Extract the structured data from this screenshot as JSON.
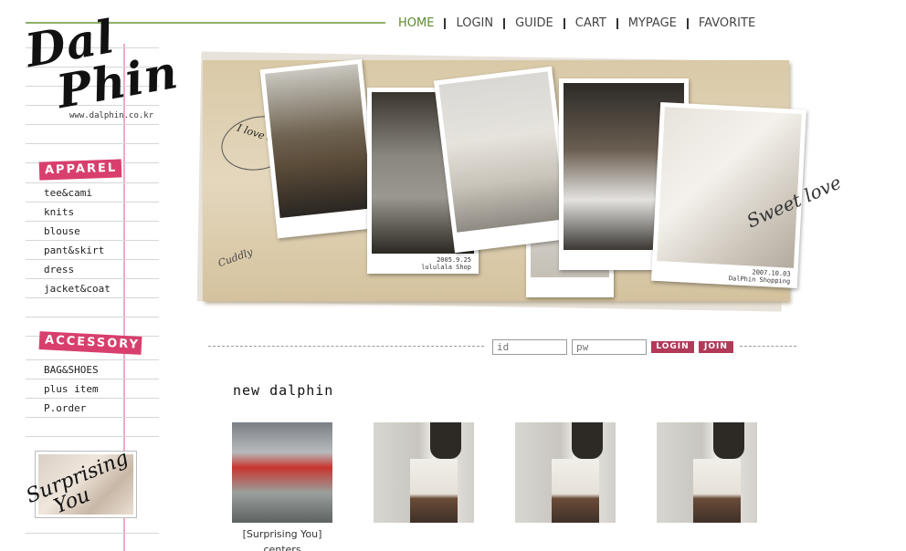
{
  "brand": {
    "logo_line1": "Dal",
    "logo_line2": "Phin",
    "url": "www.dalphin.co.kr"
  },
  "nav": {
    "items": [
      {
        "label": "HOME",
        "active": true
      },
      {
        "label": "LOGIN"
      },
      {
        "label": "GUIDE"
      },
      {
        "label": "CART"
      },
      {
        "label": "MYPAGE"
      },
      {
        "label": "FAVORITE"
      }
    ]
  },
  "sidebar": {
    "apparel_label": "APPAREL",
    "apparel_items": [
      "tee&cami",
      "knits",
      "blouse",
      "pant&skirt",
      "dress",
      "jacket&coat"
    ],
    "accessory_label": "ACCESSORY",
    "accessory_items": [
      "BAG&SHOES",
      "plus item",
      "P.order"
    ],
    "banner_text_1": "Surprising",
    "banner_text_2": "You"
  },
  "hero": {
    "script_ilove": "I love dalphin",
    "script_sweet": "Sweet love",
    "script_cuddly": "Cuddly",
    "caption_1_date": "2005.9.25",
    "caption_1_shop": "lululala Shop",
    "caption_2_date": "2007.10.03",
    "caption_2_shop": "DalPhin Shopping"
  },
  "login": {
    "id_placeholder": "id",
    "pw_placeholder": "pw",
    "login_label": "LOGIN",
    "join_label": "JOIN"
  },
  "products": {
    "section_title": "new dalphin",
    "items": [
      {
        "name": "[Surprising You]",
        "name2": "centers"
      },
      {
        "name": ""
      },
      {
        "name": ""
      },
      {
        "name": ""
      }
    ]
  },
  "colors": {
    "accent_pink": "#d83f6d",
    "nav_active_green": "#5f8a2f",
    "margin_pink": "#f2a9c8"
  }
}
